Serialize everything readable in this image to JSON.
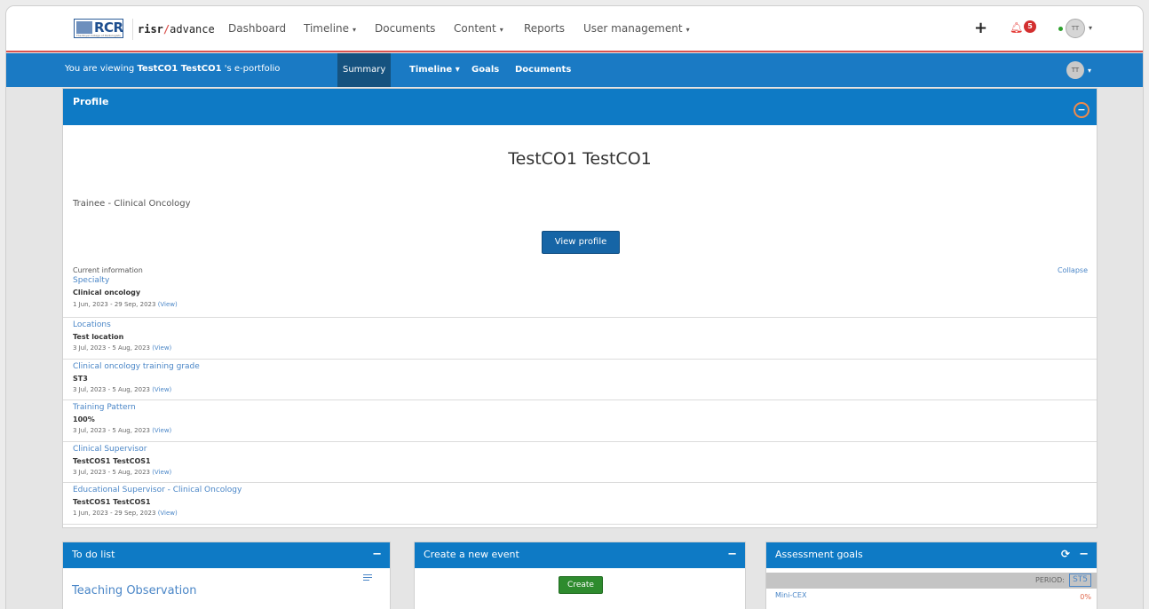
{
  "brand": {
    "logo_text": "RCR",
    "logo_subtext": "The Royal College of Radiologists",
    "name_bold": "risr",
    "name_slash": "/",
    "name_rest": "advance"
  },
  "topnav": {
    "items": [
      {
        "label": "Dashboard",
        "caret": ""
      },
      {
        "label": "Timeline",
        "caret": "▾"
      },
      {
        "label": "Documents",
        "caret": ""
      },
      {
        "label": "Content",
        "caret": "▾"
      },
      {
        "label": "Reports",
        "caret": ""
      },
      {
        "label": "User management",
        "caret": "▾"
      }
    ],
    "plus_label": "+",
    "notification_count": "5",
    "user_initials": "TT"
  },
  "subnav": {
    "viewing_prefix": "You are viewing ",
    "viewing_name": "TestCO1 TestCO1",
    "viewing_suffix": " 's e-portfolio",
    "tabs": [
      {
        "label": "Summary"
      },
      {
        "label": "Timeline ▾"
      },
      {
        "label": "Goals"
      },
      {
        "label": "Documents"
      }
    ],
    "user_initials": "TT"
  },
  "profile": {
    "panel_title": "Profile",
    "collapse_symbol": "−",
    "name": "TestCO1 TestCO1",
    "role": "Trainee - Clinical Oncology",
    "view_profile_label": "View profile",
    "current_info_label": "Current information",
    "collapse_label": "Collapse",
    "rows": [
      {
        "label": "Specialty",
        "value": "Clinical oncology",
        "dates": "1 Jun, 2023 - 29 Sep, 2023 ",
        "view": "(View)"
      },
      {
        "label": "Locations",
        "value": "Test location",
        "dates": "3 Jul, 2023 - 5 Aug, 2023 ",
        "view": "(View)"
      },
      {
        "label": "Clinical oncology training grade",
        "value": "ST3",
        "dates": "3 Jul, 2023 - 5 Aug, 2023 ",
        "view": "(View)"
      },
      {
        "label": "Training Pattern",
        "value": "100%",
        "dates": "3 Jul, 2023 - 5 Aug, 2023 ",
        "view": "(View)"
      },
      {
        "label": "Clinical Supervisor",
        "value": "TestCOS1 TestCOS1",
        "dates": "3 Jul, 2023 - 5 Aug, 2023 ",
        "view": "(View)"
      },
      {
        "label": "Educational Supervisor - Clinical Oncology",
        "value": "TestCOS1 TestCOS1",
        "dates": "1 Jun, 2023 - 29 Sep, 2023 ",
        "view": "(View)"
      }
    ]
  },
  "todo": {
    "title": "To do list",
    "minus": "−",
    "item": "Teaching Observation"
  },
  "create_event": {
    "title": "Create a new event",
    "minus": "−",
    "button_label": "Create"
  },
  "assessment_goals": {
    "title": "Assessment goals",
    "refresh": "⟳",
    "minus": "−",
    "period_label": "PERIOD:",
    "period_value": "ST5",
    "goal_name": "Mini-CEX",
    "goal_percent": "0%"
  }
}
